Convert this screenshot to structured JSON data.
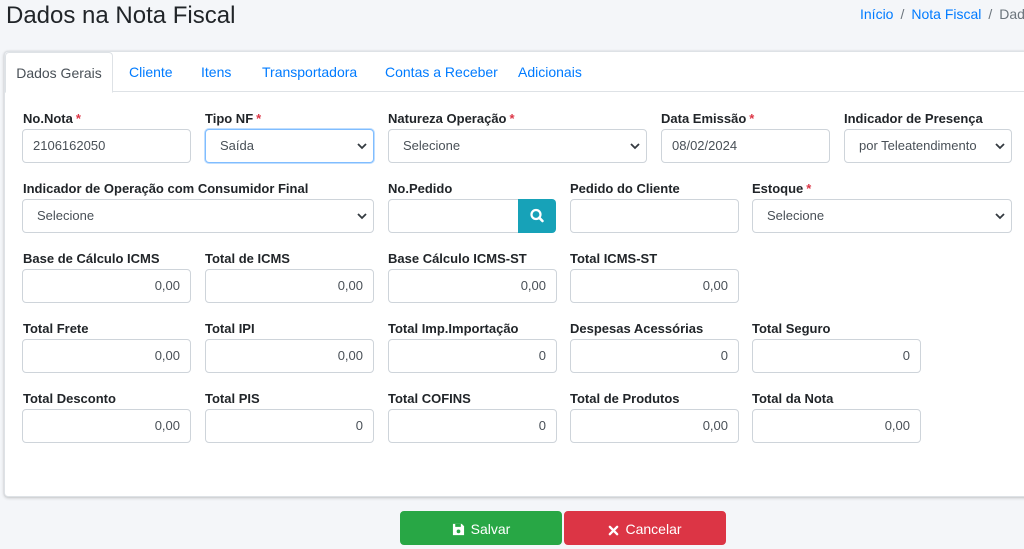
{
  "page": {
    "title": "Dados na Nota Fiscal"
  },
  "breadcrumb": {
    "home": "Início",
    "parent": "Nota Fiscal",
    "current": "Dados"
  },
  "tabs": [
    "Dados Gerais",
    "Cliente",
    "Itens",
    "Transportadora",
    "Contas a Receber",
    "Adicionais"
  ],
  "required_mark": "*",
  "fields": {
    "no_nota": {
      "label": "No.Nota",
      "value": "2106162050"
    },
    "tipo_nf": {
      "label": "Tipo NF",
      "value": "Saída"
    },
    "natureza": {
      "label": "Natureza Operação",
      "value": "Selecione"
    },
    "data_emissao": {
      "label": "Data Emissão",
      "value": "08/02/2024"
    },
    "presenca": {
      "label": "Indicador de Presença",
      "value": "por Teleatendimento"
    },
    "consumidor": {
      "label": "Indicador de Operação com Consumidor Final",
      "value": "Selecione"
    },
    "no_pedido": {
      "label": "No.Pedido",
      "value": ""
    },
    "pedido_cliente": {
      "label": "Pedido do Cliente",
      "value": ""
    },
    "estoque": {
      "label": "Estoque",
      "value": "Selecione"
    },
    "base_icms": {
      "label": "Base de Cálculo ICMS",
      "value": "0,00"
    },
    "total_icms": {
      "label": "Total de ICMS",
      "value": "0,00"
    },
    "base_icms_st": {
      "label": "Base Cálculo ICMS-ST",
      "value": "0,00"
    },
    "total_icms_st": {
      "label": "Total ICMS-ST",
      "value": "0,00"
    },
    "total_frete": {
      "label": "Total Frete",
      "value": "0,00"
    },
    "total_ipi": {
      "label": "Total IPI",
      "value": "0,00"
    },
    "total_imp_importacao": {
      "label": "Total Imp.Importação",
      "value": "0"
    },
    "despesas_acessorias": {
      "label": "Despesas Acessórias",
      "value": "0"
    },
    "total_seguro": {
      "label": "Total Seguro",
      "value": "0"
    },
    "total_desconto": {
      "label": "Total Desconto",
      "value": "0,00"
    },
    "total_pis": {
      "label": "Total PIS",
      "value": "0"
    },
    "total_cofins": {
      "label": "Total COFINS",
      "value": "0"
    },
    "total_produtos": {
      "label": "Total de Produtos",
      "value": "0,00"
    },
    "total_nota": {
      "label": "Total da Nota",
      "value": "0,00"
    }
  },
  "buttons": {
    "save": "Salvar",
    "cancel": "Cancelar"
  },
  "colors": {
    "primary": "#007bff",
    "success": "#28a745",
    "danger": "#dc3545",
    "info": "#17a2b8"
  },
  "icons": {
    "search": "search-icon",
    "save": "floppy-disk-icon",
    "cancel": "times-icon",
    "select": "chevron-down-icon"
  }
}
